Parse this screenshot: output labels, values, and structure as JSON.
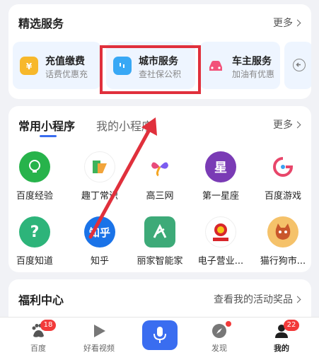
{
  "featured": {
    "title": "精选服务",
    "more": "更多",
    "services": [
      {
        "title": "充值缴费",
        "subtitle": "话费优惠充",
        "icon": "yuan-wallet-icon",
        "color": "#f7b82b"
      },
      {
        "title": "城市服务",
        "subtitle": "查社保公积",
        "icon": "city-service-icon",
        "color": "#38a8f5"
      },
      {
        "title": "车主服务",
        "subtitle": "加油有优惠",
        "icon": "car-icon",
        "color": "#f2527a"
      }
    ]
  },
  "miniprograms": {
    "tabs": [
      {
        "label": "常用小程序",
        "active": true
      },
      {
        "label": "我的小程序",
        "active": false
      }
    ],
    "more": "更多",
    "apps": [
      {
        "label": "百度经验",
        "icon": "lightbulb-icon",
        "color": "#27b34b"
      },
      {
        "label": "趣丁常识",
        "icon": "qd-logo-icon",
        "color": "#ffffff"
      },
      {
        "label": "高三网",
        "icon": "butterfly-logo-icon",
        "color": "#ffffff"
      },
      {
        "label": "第一星座",
        "icon": "star-char-icon",
        "glyph": "星",
        "color": "#7a3bb5"
      },
      {
        "label": "百度游戏",
        "icon": "game-logo-icon",
        "color": "#ffffff"
      },
      {
        "label": "百度知道",
        "icon": "question-icon",
        "glyph": "?",
        "color": "#2db47a"
      },
      {
        "label": "知乎",
        "icon": "zhihu-icon",
        "glyph": "知乎",
        "color": "#1a73e8"
      },
      {
        "label": "丽家智能家",
        "icon": "home-logo-icon",
        "color": "#3daa78"
      },
      {
        "label": "电子营业...",
        "icon": "emblem-icon",
        "color": "#ffffff"
      },
      {
        "label": "猫行狗市...",
        "icon": "cat-icon",
        "color": "#f5c26a"
      }
    ]
  },
  "welfare": {
    "title": "福利中心",
    "link": "查看我的活动奖品"
  },
  "nav": {
    "items": [
      {
        "label": "百度",
        "icon": "baidu-paw-icon",
        "badge": "18"
      },
      {
        "label": "好看视频",
        "icon": "play-icon"
      },
      {
        "label": "",
        "icon": "microphone-icon"
      },
      {
        "label": "发现",
        "icon": "compass-icon",
        "dot": true
      },
      {
        "label": "我的",
        "icon": "user-icon",
        "badge": "22",
        "active": true
      }
    ]
  },
  "colors": {
    "annotation_red": "#e0303c",
    "accent_blue": "#3a6df0"
  }
}
